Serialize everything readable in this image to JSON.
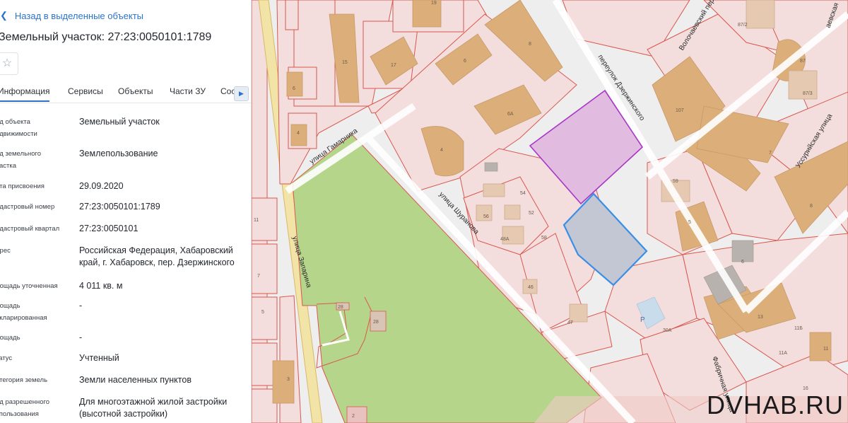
{
  "panel": {
    "back_label": "Назад в выделенные объекты",
    "title": "Земельный участок: 27:23:0050101:1789",
    "star_icon": "star-icon",
    "tabs": [
      {
        "label": "Информация",
        "active": true
      },
      {
        "label": "Сервисы"
      },
      {
        "label": "Объекты"
      },
      {
        "label": "Части ЗУ"
      },
      {
        "label": "Сос"
      }
    ],
    "rows": [
      {
        "label": "ид объекта\nедвижимости",
        "value": "Земельный участок"
      },
      {
        "label": "ид земельного\nчастка",
        "value": "Землепользование"
      },
      {
        "label": "ата присвоения",
        "value": "29.09.2020"
      },
      {
        "label": "адастровый номер",
        "value": "27:23:0050101:1789"
      },
      {
        "label": "адастровый квартал",
        "value": "27:23:0050101"
      },
      {
        "label": "дрес",
        "value": "Российская Федерация, Хабаровский край, г. Хабаровск, пер. Дзержинского"
      },
      {
        "label": "лощадь уточненная",
        "value": "4 011 кв. м"
      },
      {
        "label": "лощадь\nекларированная",
        "value": "-"
      },
      {
        "label": "лощадь",
        "value": "-"
      },
      {
        "label": "татус",
        "value": "Учтенный"
      },
      {
        "label": "атегория земель",
        "value": "Земли населенных пунктов"
      },
      {
        "label": "ид разрешенного\nспользования",
        "value": "Для многоэтажной жилой застройки (высотной застройки)"
      }
    ]
  },
  "map": {
    "streets": {
      "zaparina": "улица Запарина",
      "gamarnika": "улица Гамарника",
      "shuranova": "улица Шуранова",
      "dzerzhinskogo": "переулок Дзержинского",
      "volochaevsky": "Волочаевский переулок",
      "ussuriyskaya": "Уссурийская улица",
      "fabrichnaya": "Фабричная улица",
      "volochaevskaya_partial": "аевская"
    },
    "building_numbers": {
      "b19": "19",
      "b17": "17",
      "b15": "15",
      "b6a": "6",
      "b4a": "4",
      "b6": "6",
      "b8": "8",
      "b6A": "6А",
      "b4": "4",
      "b54": "54",
      "b56": "56",
      "b52": "52",
      "b48": "48А",
      "b58": "58",
      "b46": "46",
      "b47": "47",
      "b87_2": "87/2",
      "b87": "87",
      "b87_3": "87/3",
      "b107": "107",
      "b7": "7",
      "b8r": "8",
      "b59": "59",
      "b5": "5",
      "b6r": "6",
      "b13": "13",
      "b30a": "30А",
      "b11b": "11Б",
      "b11": "11",
      "b11a": "11А",
      "b16": "16",
      "b3": "3",
      "b5l": "5",
      "b7l": "7",
      "b11l": "11",
      "b28a": "28",
      "b28": "28",
      "b2": "2",
      "bP": "Р"
    },
    "colors": {
      "parcel_fill": "#f3dedd",
      "parcel_line": "#d9574f",
      "building": "#dcae7a",
      "green": "#b5d68a",
      "selected_purple": "#a836c7",
      "selected_blue": "#3a8ee6",
      "blue_fill": "#c3c7d4",
      "purple_fill": "#e2bce0"
    }
  },
  "watermark": "DVHAB.RU"
}
